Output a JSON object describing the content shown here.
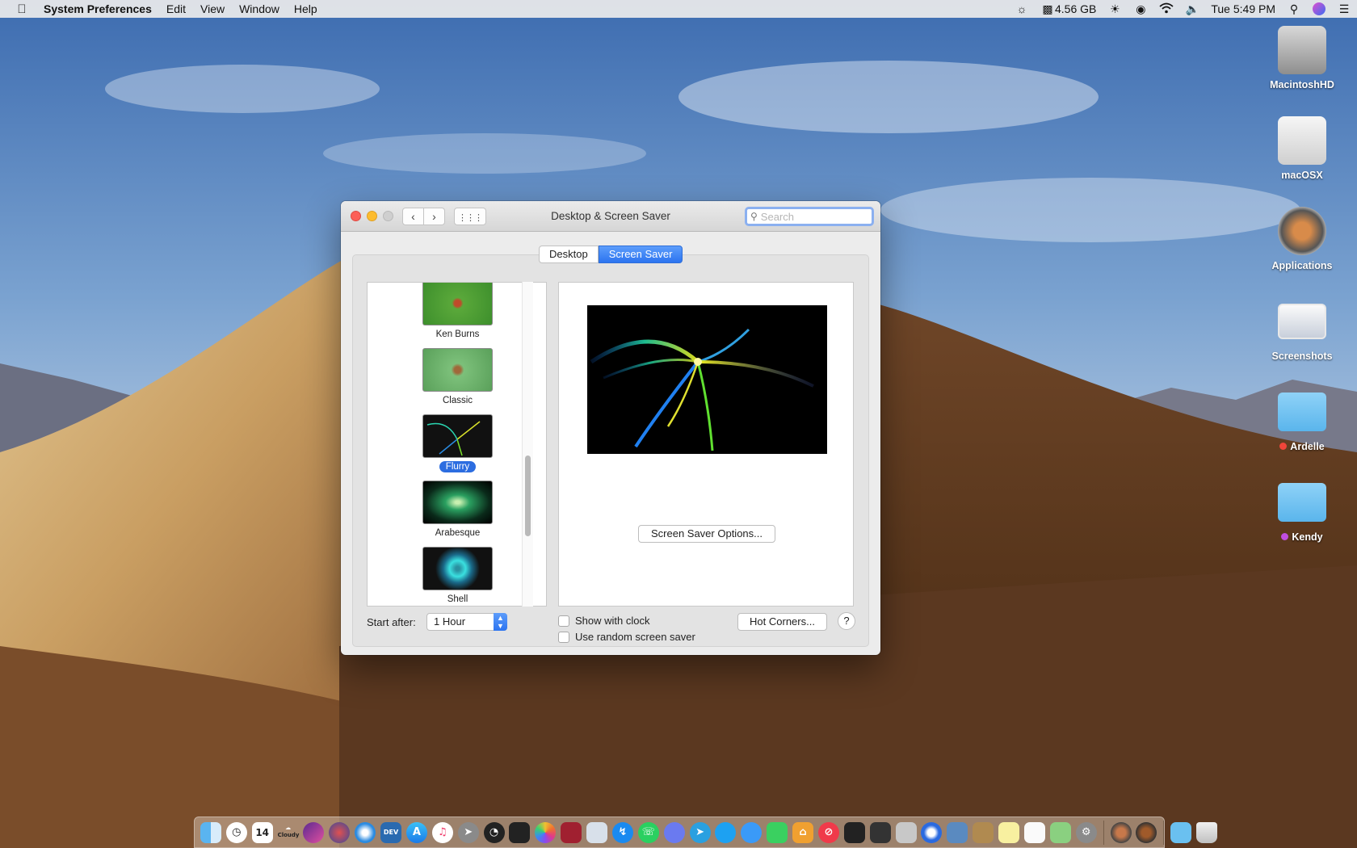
{
  "menubar": {
    "app_name": "System Preferences",
    "menus": [
      "Edit",
      "View",
      "Window",
      "Help"
    ],
    "memory": "4.56 GB",
    "clock": "Tue 5:49 PM"
  },
  "desktop_icons": [
    {
      "label": "MacintoshHD",
      "icon": "hard-drive-icon"
    },
    {
      "label": "macOSX",
      "icon": "external-drive-icon"
    },
    {
      "label": "Applications",
      "icon": "applications-icon"
    },
    {
      "label": "Screenshots",
      "icon": "screenshots-icon"
    },
    {
      "label": "Ardelle",
      "icon": "folder-icon",
      "tag_color": "#f0453a"
    },
    {
      "label": "Kendy",
      "icon": "folder-icon",
      "tag_color": "#c04ee0"
    }
  ],
  "window": {
    "title": "Desktop & Screen Saver",
    "search_placeholder": "Search",
    "tabs": [
      "Desktop",
      "Screen Saver"
    ],
    "active_tab": "Screen Saver",
    "savers": [
      {
        "name": "Ken Burns"
      },
      {
        "name": "Classic"
      },
      {
        "name": "Flurry",
        "selected": true
      },
      {
        "name": "Arabesque"
      },
      {
        "name": "Shell"
      }
    ],
    "options_button": "Screen Saver Options...",
    "start_after_label": "Start after:",
    "start_after_value": "1 Hour",
    "show_clock_label": "Show with clock",
    "random_label": "Use random screen saver",
    "hot_corners_button": "Hot Corners...",
    "help_button": "?"
  },
  "accent_color": "#2c74f0",
  "dock": {
    "calendar_day": "14",
    "weather_text": "Cloudy",
    "icons": [
      "finder-icon",
      "clock-icon",
      "calendar-icon",
      "weather-icon",
      "siri-icon",
      "launchpad-icon",
      "safari-icon",
      "xcode-icon",
      "app-store-icon",
      "music-icon",
      "rocket-icon",
      "dashboard-icon",
      "terminal-icon",
      "photos-icon",
      "photo-booth-icon",
      "preview-icon",
      "messenger-icon",
      "whatsapp-icon",
      "discord-icon",
      "telegram-icon",
      "twitter-icon",
      "messages-icon",
      "facetime-icon",
      "home-icon",
      "news-icon",
      "activity-monitor-icon",
      "console-icon",
      "disk-icon",
      "quicktime-icon",
      "image-capture-icon",
      "notes-icon",
      "stickies-icon",
      "textedit-icon",
      "maps-icon",
      "system-preferences-icon",
      "mojave-icon",
      "desert-icon",
      "downloads-folder-icon",
      "trash-icon"
    ]
  }
}
